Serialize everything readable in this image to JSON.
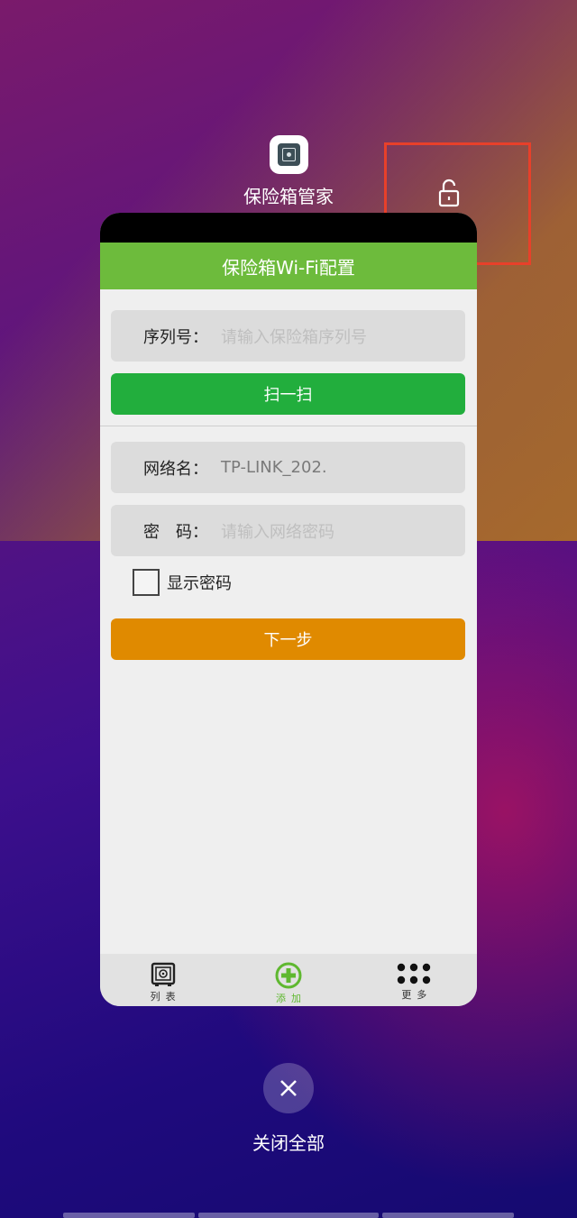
{
  "recents": {
    "app_name": "保险箱管家",
    "close_all_label": "关闭全部"
  },
  "screen": {
    "title": "保险箱Wi-Fi配置",
    "serial": {
      "label": "序列号：",
      "placeholder": "请输入保险箱序列号"
    },
    "scan_button": "扫一扫",
    "network": {
      "label": "网络名：",
      "value": "TP-LINK_202."
    },
    "password": {
      "label": "密　码：",
      "placeholder": "请输入网络密码"
    },
    "show_password": "显示密码",
    "next_button": "下一步"
  },
  "tabs": [
    {
      "label": "列表",
      "icon": "safe-icon"
    },
    {
      "label": "添加",
      "icon": "add-circle-icon",
      "active": true
    },
    {
      "label": "更多",
      "icon": "more-dots-icon"
    }
  ],
  "colors": {
    "title_bar": "#6dbb3c",
    "scan_button": "#22ae3d",
    "next_button": "#e08a00",
    "highlight": "#e8402a"
  }
}
